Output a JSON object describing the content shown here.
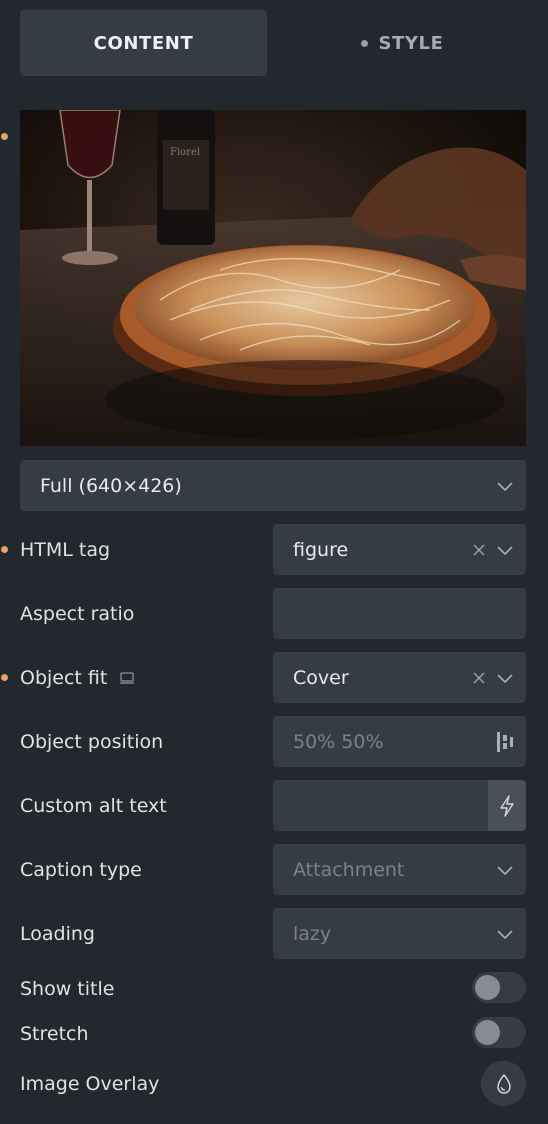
{
  "tabs": {
    "content": "CONTENT",
    "style": "STYLE"
  },
  "image": {
    "size_select": "Full (640×426)"
  },
  "fields": {
    "html_tag": {
      "label": "HTML tag",
      "value": "figure"
    },
    "aspect_ratio": {
      "label": "Aspect ratio",
      "value": ""
    },
    "object_fit": {
      "label": "Object fit",
      "value": "Cover"
    },
    "object_position": {
      "label": "Object position",
      "placeholder": "50% 50%"
    },
    "custom_alt": {
      "label": "Custom alt text",
      "value": ""
    },
    "caption_type": {
      "label": "Caption type",
      "placeholder": "Attachment"
    },
    "loading": {
      "label": "Loading",
      "placeholder": "lazy"
    },
    "show_title": {
      "label": "Show title",
      "on": false
    },
    "stretch": {
      "label": "Stretch",
      "on": false
    },
    "image_overlay": {
      "label": "Image Overlay"
    }
  },
  "colors": {
    "accent_dot": "#e3a65a",
    "panel": "#23272e",
    "control": "#363c46"
  },
  "icons": [
    "chevron-down-icon",
    "close-icon",
    "align-icon",
    "bolt-icon",
    "monitor-icon",
    "droplet-icon"
  ]
}
